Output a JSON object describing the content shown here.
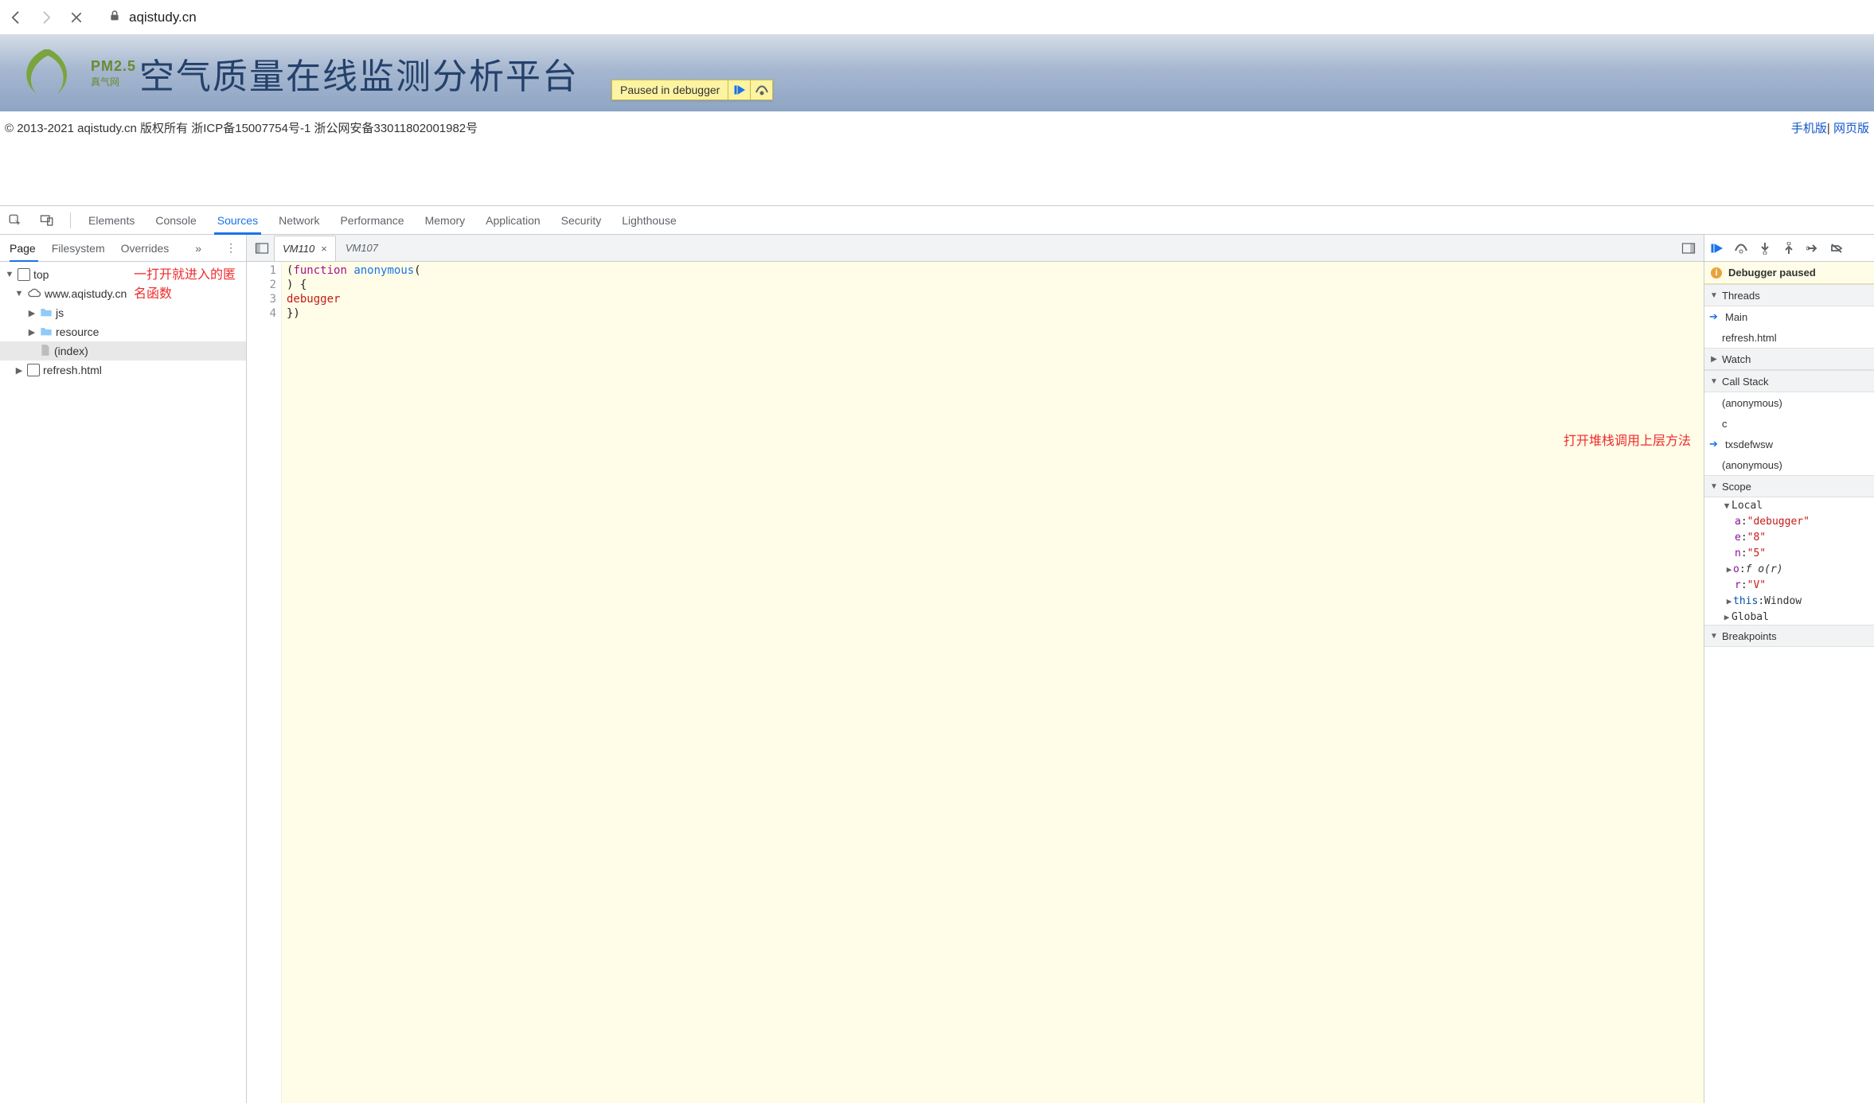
{
  "browser": {
    "url": "aqistudy.cn"
  },
  "page": {
    "logo_pm25": "PM2.5",
    "logo_sub": "真气网",
    "banner_title": "空气质量在线监测分析平台",
    "paused_overlay": "Paused in debugger",
    "footer_copyright": "© 2013-2021 aqistudy.cn 版权所有 浙ICP备15007754号-1 浙公网安备33011802001982号",
    "footer_link_mobile": "手机版",
    "footer_link_web": "网页版"
  },
  "annotations": {
    "tree": "一打开就进入的匿名函数",
    "callstack": "打开堆栈调用上层方法"
  },
  "devtools": {
    "tabs": [
      "Elements",
      "Console",
      "Sources",
      "Network",
      "Performance",
      "Memory",
      "Application",
      "Security",
      "Lighthouse"
    ],
    "active_tab": "Sources",
    "source_nav_tabs": [
      "Page",
      "Filesystem",
      "Overrides"
    ],
    "source_nav_active": "Page",
    "tree": {
      "top": "top",
      "domain": "www.aqistudy.cn",
      "folders": [
        "js",
        "resource"
      ],
      "index": "(index)",
      "refresh": "refresh.html"
    },
    "editor_tabs": [
      "VM110",
      "VM107"
    ],
    "editor_active": "VM110",
    "code_lines": [
      "(",
      "function",
      " anonymous",
      "(",
      ") {",
      "debugger",
      "})"
    ],
    "debugger": {
      "status": "Debugger paused",
      "sections": {
        "threads_h": "Threads",
        "threads": [
          "Main",
          "refresh.html"
        ],
        "watch_h": "Watch",
        "callstack_h": "Call Stack",
        "callstack": [
          "(anonymous)",
          "c",
          "txsdefwsw",
          "(anonymous)"
        ],
        "scope_h": "Scope",
        "scope_local_h": "Local",
        "scope_local": [
          {
            "k": "a",
            "v": "\"debugger\""
          },
          {
            "k": "e",
            "v": "\"8\""
          },
          {
            "k": "n",
            "v": "\"5\""
          },
          {
            "k": "o",
            "v": "f o(r)",
            "exp": true,
            "ital": true
          },
          {
            "k": "r",
            "v": "\"V\""
          },
          {
            "k": "this",
            "v": "Window",
            "exp": true,
            "blue": true
          }
        ],
        "scope_global_h": "Global",
        "breakpoints_h": "Breakpoints"
      }
    }
  }
}
